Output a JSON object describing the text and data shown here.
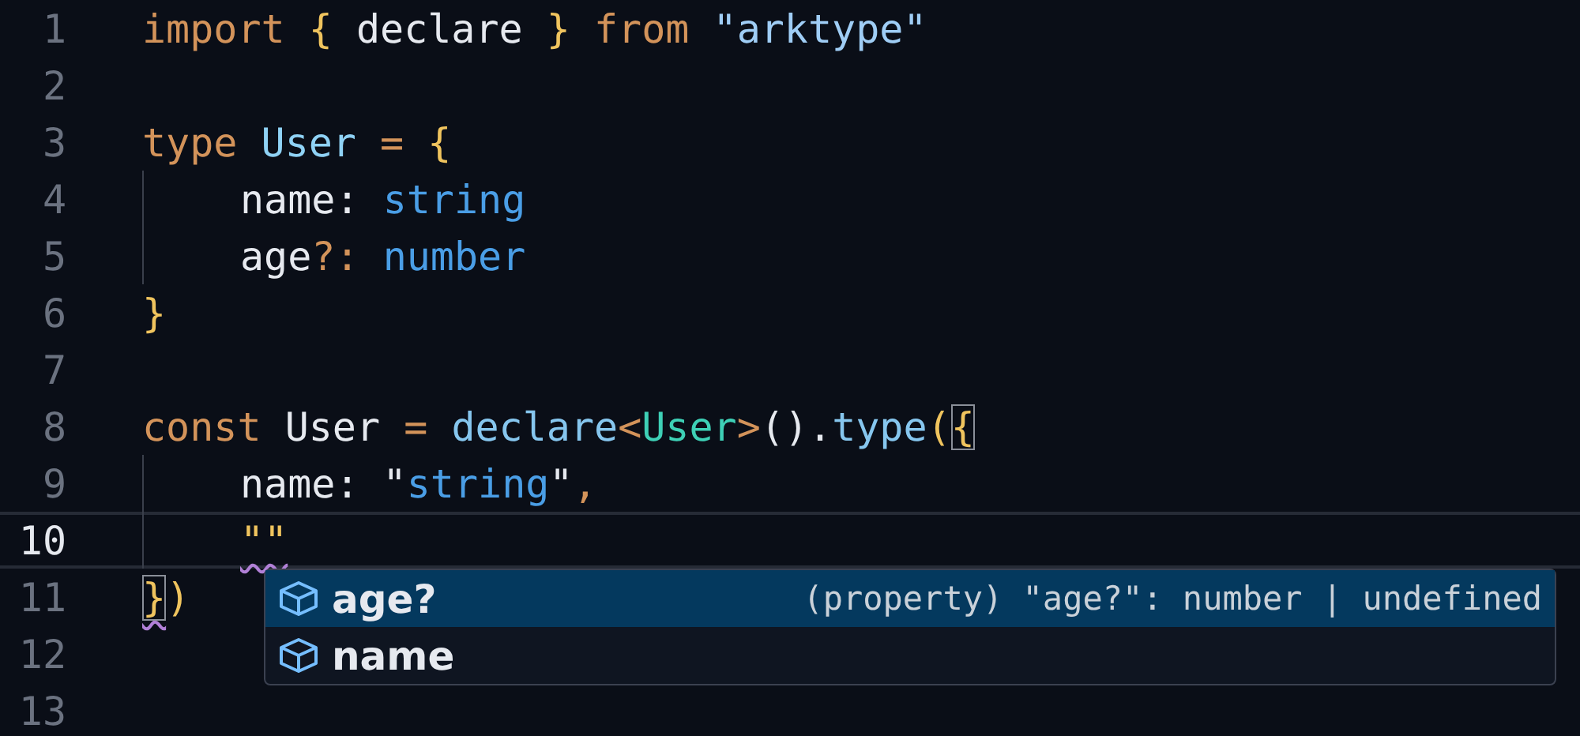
{
  "editor": {
    "lines": [
      {
        "number": "1",
        "current": false,
        "indented": false,
        "tokens": [
          {
            "kind": "keyword",
            "text": "import",
            "matched": false,
            "squiggle": false
          },
          {
            "kind": "brace",
            "text": " {",
            "matched": false,
            "squiggle": false
          },
          {
            "kind": "plain",
            "text": " declare ",
            "matched": false,
            "squiggle": false
          },
          {
            "kind": "brace",
            "text": "}",
            "matched": false,
            "squiggle": false
          },
          {
            "kind": "keyword",
            "text": " from",
            "matched": false,
            "squiggle": false
          },
          {
            "kind": "string",
            "text": " \"arktype\"",
            "matched": false,
            "squiggle": false
          }
        ]
      },
      {
        "number": "2",
        "current": false,
        "indented": false
      },
      {
        "number": "3",
        "current": false,
        "indented": false,
        "tokens": [
          {
            "kind": "keyword",
            "text": "type",
            "matched": false,
            "squiggle": false
          },
          {
            "kind": "typename",
            "text": " User",
            "matched": false,
            "squiggle": false
          },
          {
            "kind": "keyword",
            "text": " =",
            "matched": false,
            "squiggle": false
          },
          {
            "kind": "brace",
            "text": " {",
            "matched": false,
            "squiggle": false
          }
        ]
      },
      {
        "number": "4",
        "current": false,
        "indented": true,
        "tokens": [
          {
            "kind": "plain",
            "text": "name: ",
            "matched": false,
            "squiggle": false
          },
          {
            "kind": "builtin",
            "text": "string",
            "matched": false,
            "squiggle": false
          }
        ]
      },
      {
        "number": "5",
        "current": false,
        "indented": true,
        "tokens": [
          {
            "kind": "plain",
            "text": "age",
            "matched": false,
            "squiggle": false
          },
          {
            "kind": "keyword",
            "text": "?:",
            "matched": false,
            "squiggle": false
          },
          {
            "kind": "builtin",
            "text": " number",
            "matched": false,
            "squiggle": false
          }
        ]
      },
      {
        "number": "6",
        "current": false,
        "indented": false,
        "tokens": [
          {
            "kind": "brace",
            "text": "}",
            "matched": false,
            "squiggle": false
          }
        ]
      },
      {
        "number": "7",
        "current": false,
        "indented": false
      },
      {
        "number": "8",
        "current": false,
        "indented": false,
        "tokens": [
          {
            "kind": "keyword",
            "text": "const",
            "matched": false,
            "squiggle": false
          },
          {
            "kind": "plain",
            "text": " User ",
            "matched": false,
            "squiggle": false
          },
          {
            "kind": "keyword",
            "text": "=",
            "matched": false,
            "squiggle": false
          },
          {
            "kind": "function",
            "text": " declare",
            "matched": false,
            "squiggle": false
          },
          {
            "kind": "keyword",
            "text": "<",
            "matched": false,
            "squiggle": false
          },
          {
            "kind": "generic",
            "text": "User",
            "matched": false,
            "squiggle": false
          },
          {
            "kind": "keyword",
            "text": ">",
            "matched": false,
            "squiggle": false
          },
          {
            "kind": "plain",
            "text": "().",
            "matched": false,
            "squiggle": false
          },
          {
            "kind": "function",
            "text": "type",
            "matched": false,
            "squiggle": false
          },
          {
            "kind": "brace",
            "text": "(",
            "matched": false,
            "squiggle": false
          },
          {
            "kind": "brace",
            "text": "{",
            "matched": true,
            "squiggle": false
          }
        ]
      },
      {
        "number": "9",
        "current": false,
        "indented": true,
        "tokens": [
          {
            "kind": "plain",
            "text": "name: \"",
            "matched": false,
            "squiggle": false
          },
          {
            "kind": "builtin",
            "text": "string",
            "matched": false,
            "squiggle": false
          },
          {
            "kind": "plain",
            "text": "\"",
            "matched": false,
            "squiggle": false
          },
          {
            "kind": "keyword",
            "text": ",",
            "matched": false,
            "squiggle": false
          }
        ]
      },
      {
        "number": "10",
        "current": true,
        "indented": true,
        "tokens": [
          {
            "kind": "brace",
            "text": "\"\"",
            "matched": false,
            "squiggle": true
          }
        ]
      },
      {
        "number": "11",
        "current": false,
        "indented": false,
        "tokens": [
          {
            "kind": "brace",
            "text": "}",
            "matched": true,
            "squiggle": true
          },
          {
            "kind": "brace",
            "text": ")",
            "matched": false,
            "squiggle": false
          }
        ]
      },
      {
        "number": "12",
        "current": false,
        "indented": false
      },
      {
        "number": "13",
        "current": false,
        "indented": false
      }
    ]
  },
  "suggestions": [
    {
      "label": "age?",
      "detail": "(property) \"age?\": number | undefined",
      "selected": true
    },
    {
      "label": "name",
      "selected": false
    }
  ]
}
